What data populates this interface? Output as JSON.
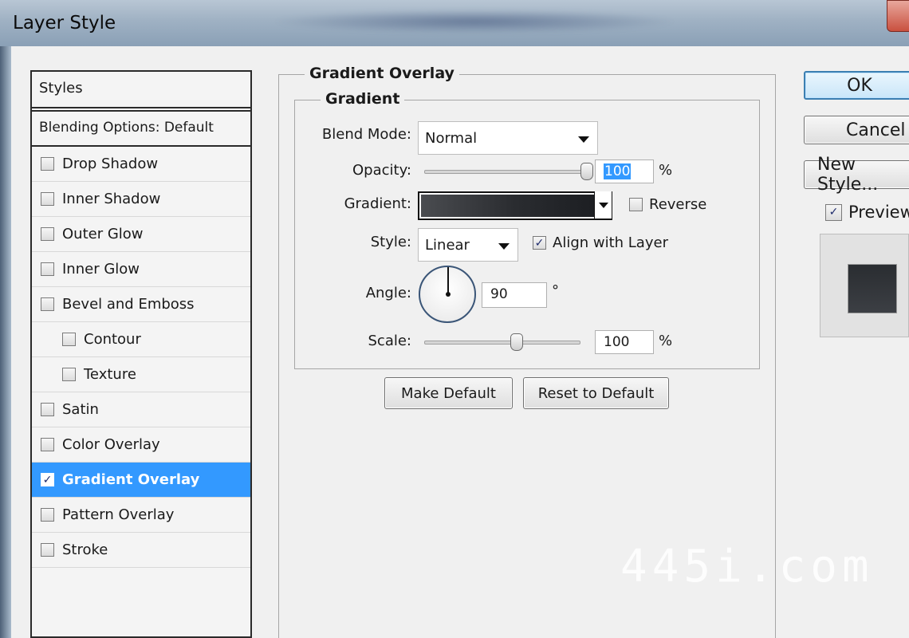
{
  "window": {
    "title": "Layer Style"
  },
  "styles_panel": {
    "header": "Styles",
    "blending_options": "Blending Options: Default",
    "items": [
      {
        "label": "Drop Shadow",
        "checked": false
      },
      {
        "label": "Inner Shadow",
        "checked": false
      },
      {
        "label": "Outer Glow",
        "checked": false
      },
      {
        "label": "Inner Glow",
        "checked": false
      },
      {
        "label": "Bevel and Emboss",
        "checked": false
      },
      {
        "label": "Contour",
        "checked": false
      },
      {
        "label": "Texture",
        "checked": false
      },
      {
        "label": "Satin",
        "checked": false
      },
      {
        "label": "Color Overlay",
        "checked": false
      },
      {
        "label": "Gradient Overlay",
        "checked": true
      },
      {
        "label": "Pattern Overlay",
        "checked": false
      },
      {
        "label": "Stroke",
        "checked": false
      }
    ]
  },
  "gradient_overlay": {
    "group_title": "Gradient Overlay",
    "subgroup_title": "Gradient",
    "blend_mode_label": "Blend Mode:",
    "blend_mode_value": "Normal",
    "opacity_label": "Opacity:",
    "opacity_value": "100",
    "opacity_unit": "%",
    "opacity_level": 1.0,
    "gradient_label": "Gradient:",
    "reverse_label": "Reverse",
    "reverse_checked": false,
    "style_label": "Style:",
    "style_value": "Linear",
    "align_label": "Align with Layer",
    "align_checked": true,
    "angle_label": "Angle:",
    "angle_value": "90",
    "angle_unit": "°",
    "scale_label": "Scale:",
    "scale_value": "100",
    "scale_unit": "%",
    "scale_level": 0.6,
    "make_default": "Make Default",
    "reset_default": "Reset to Default"
  },
  "actions": {
    "ok": "OK",
    "cancel": "Cancel",
    "new_style": "New Style...",
    "preview_label": "Preview",
    "preview_checked": true
  },
  "watermark": "445i.com"
}
